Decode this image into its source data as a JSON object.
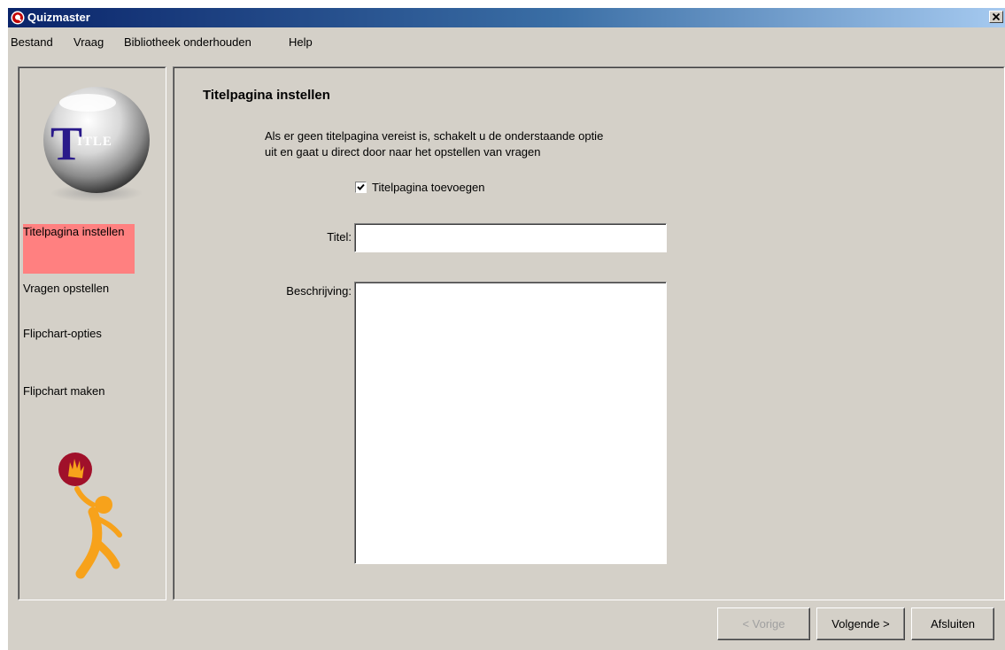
{
  "window": {
    "title": "Quizmaster",
    "close_symbol": "✕"
  },
  "menu": {
    "items": [
      {
        "label": "Bestand"
      },
      {
        "label": "Vraag"
      },
      {
        "label": "Bibliotheek onderhouden"
      },
      {
        "label": "Help"
      }
    ]
  },
  "sidebar": {
    "logo_text": "TITLE",
    "steps": [
      {
        "label": "Titelpagina instellen",
        "active": true
      },
      {
        "label": "Vragen opstellen",
        "active": false
      },
      {
        "label": "Flipchart-opties",
        "active": false
      },
      {
        "label": "Flipchart maken",
        "active": false
      }
    ],
    "active_color": "#ff8080"
  },
  "main": {
    "title": "Titelpagina instellen",
    "intro_line1": "Als er geen titelpagina vereist is, schakelt u de onderstaande optie",
    "intro_line2": "uit en gaat u direct door naar het opstellen van vragen",
    "checkbox_label": "Titelpagina toevoegen",
    "checkbox_checked": true,
    "titel_label": "Titel:",
    "titel_value": "",
    "beschrijving_label": "Beschrijving:",
    "beschrijving_value": ""
  },
  "footer": {
    "prev_label": "< Vorige",
    "next_label": "Volgende >",
    "close_label": "Afsluiten"
  },
  "colors": {
    "titlebar_start": "#0a246a",
    "titlebar_end": "#a6caf0",
    "face": "#d4d0c8",
    "logo_red": "#c00000",
    "mascot_orange": "#f7a21b"
  }
}
